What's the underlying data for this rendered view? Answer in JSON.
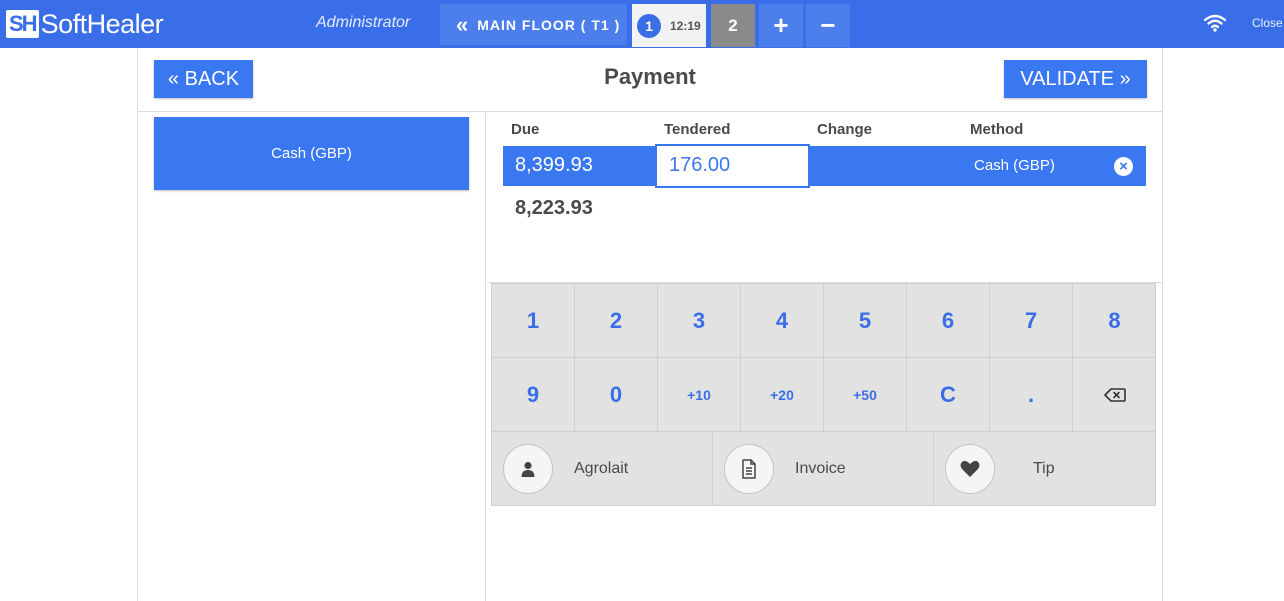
{
  "topbar": {
    "logo_mark": "SH",
    "logo_text": "SoftHealer",
    "user": "Administrator",
    "floor_label": "MAIN FLOOR ( T1 )",
    "orders": [
      {
        "number": "1",
        "time": "12:19"
      },
      {
        "number": "2"
      }
    ],
    "add_label": "+",
    "remove_label": "−",
    "close_label": "Close",
    "icons": {
      "wifi": "wifi-icon",
      "back_chevron": "double-chevron-left-icon"
    }
  },
  "payment": {
    "back_label": "« BACK",
    "title": "Payment",
    "validate_label": "VALIDATE »",
    "methods": [
      {
        "label": "Cash (GBP)"
      }
    ],
    "columns": {
      "due": "Due",
      "tendered": "Tendered",
      "change": "Change",
      "method": "Method"
    },
    "line": {
      "due": "8,399.93",
      "tendered": "176.00",
      "change": "",
      "method": "Cash (GBP)"
    },
    "remaining": "8,223.93"
  },
  "numpad": {
    "row1": [
      "1",
      "2",
      "3",
      "4",
      "5",
      "6",
      "7",
      "8"
    ],
    "row2": [
      "9",
      "0",
      "+10",
      "+20",
      "+50",
      "C",
      ".",
      "⌫"
    ]
  },
  "actions": [
    {
      "label": "Agrolait",
      "icon": "user-icon"
    },
    {
      "label": "Invoice",
      "icon": "document-icon"
    },
    {
      "label": "Tip",
      "icon": "heart-icon"
    }
  ],
  "colors": {
    "accent": "#3a6ee8",
    "button": "#3a78f2",
    "numpad_bg": "#e2e2e2"
  }
}
